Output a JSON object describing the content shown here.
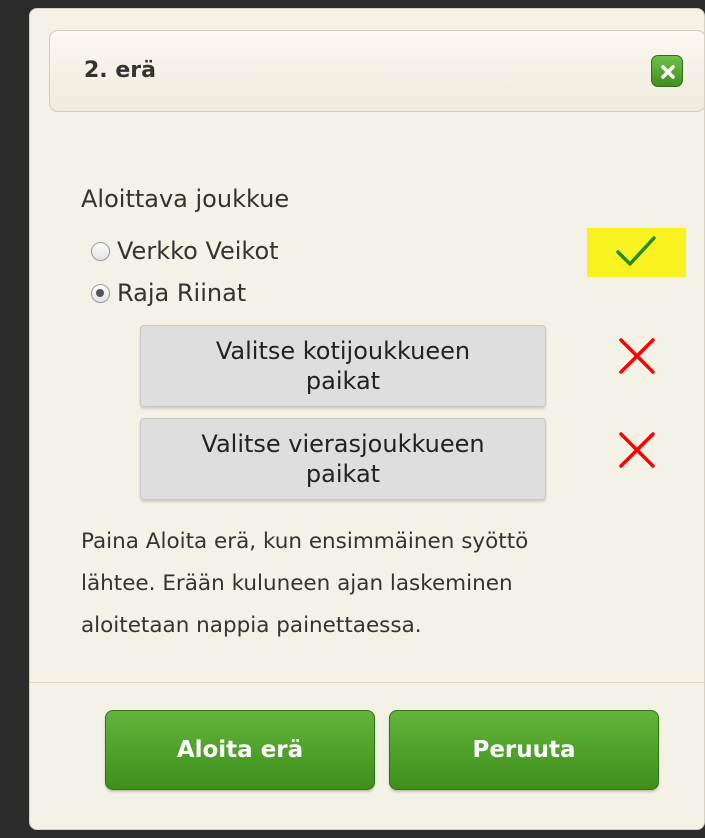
{
  "dialog": {
    "title": "2. erä",
    "close_icon": "close-icon",
    "starting_team_label": "Aloittava joukkue",
    "teams": [
      {
        "label": "Verkko Veikot",
        "selected": false
      },
      {
        "label": "Raja Riinat",
        "selected": true
      }
    ],
    "selection_status_icon": "checkmark-icon",
    "selection_status_color": "#2a8a1c",
    "highlight_color": "#f7f220",
    "home_positions_button": [
      "Valitse kotijoukkueen",
      "paikat"
    ],
    "home_positions_status_icon": "cross-icon",
    "away_positions_button": [
      "Valitse vierasjoukkueen",
      "paikat"
    ],
    "away_positions_status_icon": "cross-icon",
    "status_cross_color": "#ff0000",
    "info_text": [
      "Paina Aloita erä, kun ensimmäinen syöttö",
      "lähtee. Erään kuluneen ajan laskeminen",
      "aloitetaan nappia painettaessa."
    ],
    "start_button": "Aloita erä",
    "cancel_button": "Peruuta"
  }
}
